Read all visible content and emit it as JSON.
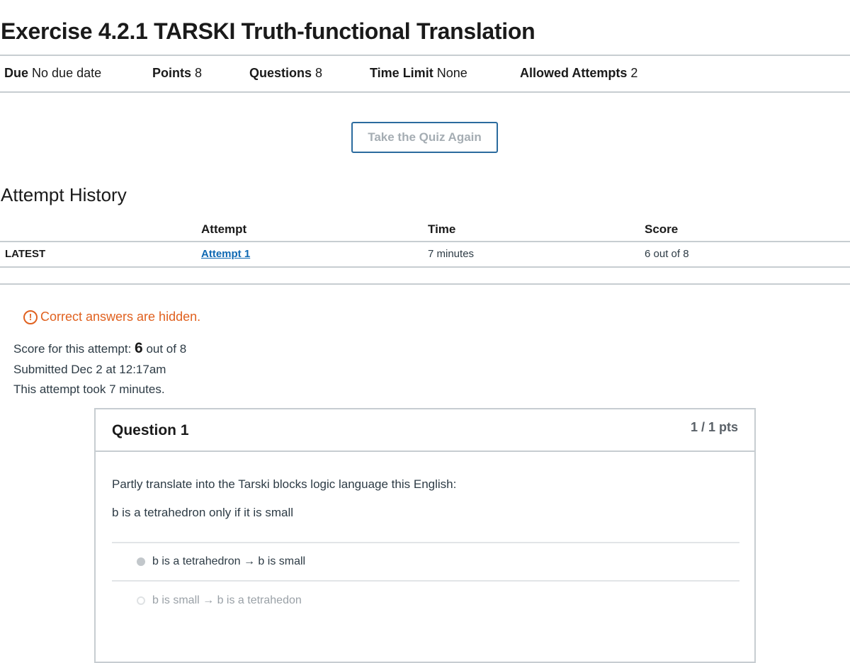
{
  "quiz": {
    "title": "Exercise 4.2.1 TARSKI Truth-functional Translation",
    "meta": [
      {
        "label": "Due",
        "value": "No due date"
      },
      {
        "label": "Points",
        "value": "8"
      },
      {
        "label": "Questions",
        "value": "8"
      },
      {
        "label": "Time Limit",
        "value": "None"
      },
      {
        "label": "Allowed Attempts",
        "value": "2"
      }
    ],
    "retake_label": "Take the Quiz Again"
  },
  "history": {
    "title": "Attempt History",
    "headers": {
      "attempt": "Attempt",
      "time": "Time",
      "score": "Score"
    },
    "rows": [
      {
        "tag": "LATEST",
        "attempt": "Attempt 1",
        "time": "7 minutes",
        "score": "6 out of 8"
      }
    ]
  },
  "result": {
    "warning": "Correct answers are hidden.",
    "score_prefix": "Score for this attempt:",
    "score_value": "6",
    "score_suffix": "out of 8",
    "submitted": "Submitted Dec 2 at 12:17am",
    "duration": "This attempt took 7 minutes."
  },
  "question": {
    "name": "Question 1",
    "points": "1 / 1 pts",
    "prompt": "Partly translate into the Tarski blocks logic language this English:",
    "sentence": "b is a tetrahedron only if it is small",
    "answers": [
      {
        "text": "b is a tetrahedron → b is small",
        "selected": true
      },
      {
        "text": "b is small → b is a tetrahedon",
        "selected": false
      }
    ]
  },
  "colors": {
    "accent_link": "#0e68b3",
    "warning": "#e0611f",
    "border": "#c7cdd1",
    "button_border": "#2b6b9e"
  }
}
